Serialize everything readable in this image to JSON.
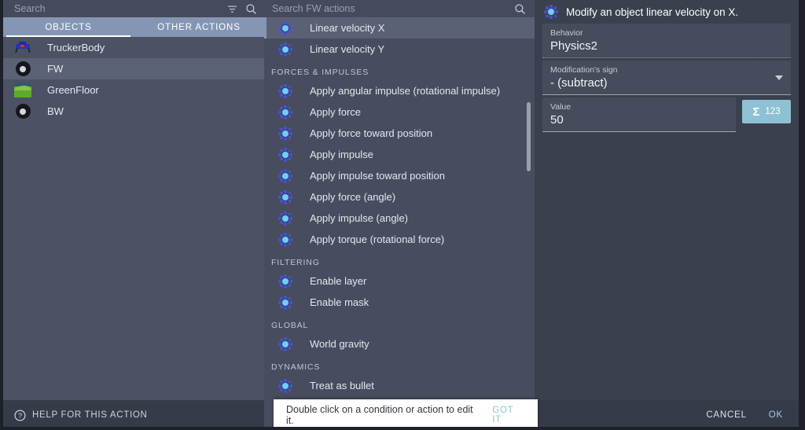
{
  "left_panel": {
    "search": {
      "placeholder": "Search",
      "value": ""
    },
    "filter_icon": "filter-icon",
    "search_icon": "search-icon",
    "tabs": [
      {
        "label": "OBJECTS",
        "active": true
      },
      {
        "label": "OTHER ACTIONS",
        "active": false
      }
    ],
    "objects": [
      {
        "label": "TruckerBody",
        "thumb": "truck-sprite",
        "selected": false
      },
      {
        "label": "FW",
        "thumb": "wheel-sprite",
        "selected": true
      },
      {
        "label": "GreenFloor",
        "thumb": "floor-sprite",
        "selected": false
      },
      {
        "label": "BW",
        "thumb": "wheel-sprite",
        "selected": false
      }
    ],
    "footer": {
      "help_label": "HELP FOR THIS ACTION",
      "help_icon": "question-circle-icon"
    }
  },
  "mid_panel": {
    "search": {
      "placeholder": "Search FW actions",
      "value": ""
    },
    "search_icon": "search-icon",
    "items": [
      {
        "type": "action",
        "label": "Linear velocity X",
        "selected": true
      },
      {
        "type": "action",
        "label": "Linear velocity Y",
        "selected": false
      },
      {
        "type": "group",
        "label": "FORCES & IMPULSES"
      },
      {
        "type": "action",
        "label": "Apply angular impulse (rotational impulse)",
        "selected": false
      },
      {
        "type": "action",
        "label": "Apply force",
        "selected": false
      },
      {
        "type": "action",
        "label": "Apply force toward position",
        "selected": false
      },
      {
        "type": "action",
        "label": "Apply impulse",
        "selected": false
      },
      {
        "type": "action",
        "label": "Apply impulse toward position",
        "selected": false
      },
      {
        "type": "action",
        "label": "Apply force (angle)",
        "selected": false
      },
      {
        "type": "action",
        "label": "Apply impulse (angle)",
        "selected": false
      },
      {
        "type": "action",
        "label": "Apply torque (rotational force)",
        "selected": false
      },
      {
        "type": "group",
        "label": "FILTERING"
      },
      {
        "type": "action",
        "label": "Enable layer",
        "selected": false
      },
      {
        "type": "action",
        "label": "Enable mask",
        "selected": false
      },
      {
        "type": "group",
        "label": "GLOBAL"
      },
      {
        "type": "action",
        "label": "World gravity",
        "selected": false
      },
      {
        "type": "group",
        "label": "DYNAMICS"
      },
      {
        "type": "action",
        "label": "Treat as bullet",
        "selected": false
      }
    ]
  },
  "right_panel": {
    "title": "Modify an object linear velocity on X.",
    "title_icon": "physics-atom-icon",
    "fields": {
      "behavior": {
        "label": "Behavior",
        "value": "Physics2"
      },
      "sign": {
        "label": "Modification's sign",
        "value": "- (subtract)",
        "caret_icon": "chevron-down-icon"
      },
      "value": {
        "label": "Value",
        "value": "50"
      }
    },
    "expression_button": {
      "glyph": "Σ",
      "number": "123",
      "name": "sigma-123-button"
    },
    "footer": {
      "cancel": "CANCEL",
      "ok": "OK"
    }
  },
  "toast": {
    "text": "Double click on a condition or action to edit it.",
    "action": "GOT IT"
  },
  "colors": {
    "accent_blue": "#8596b4",
    "sigma_bg": "#8fc1d4",
    "panel_left": "#4c5264",
    "panel_mid": "#474d5f",
    "panel_right": "#3b404e",
    "footer": "#363b49",
    "selected_row": "#5b6276",
    "toast_bg": "#ffffff"
  }
}
